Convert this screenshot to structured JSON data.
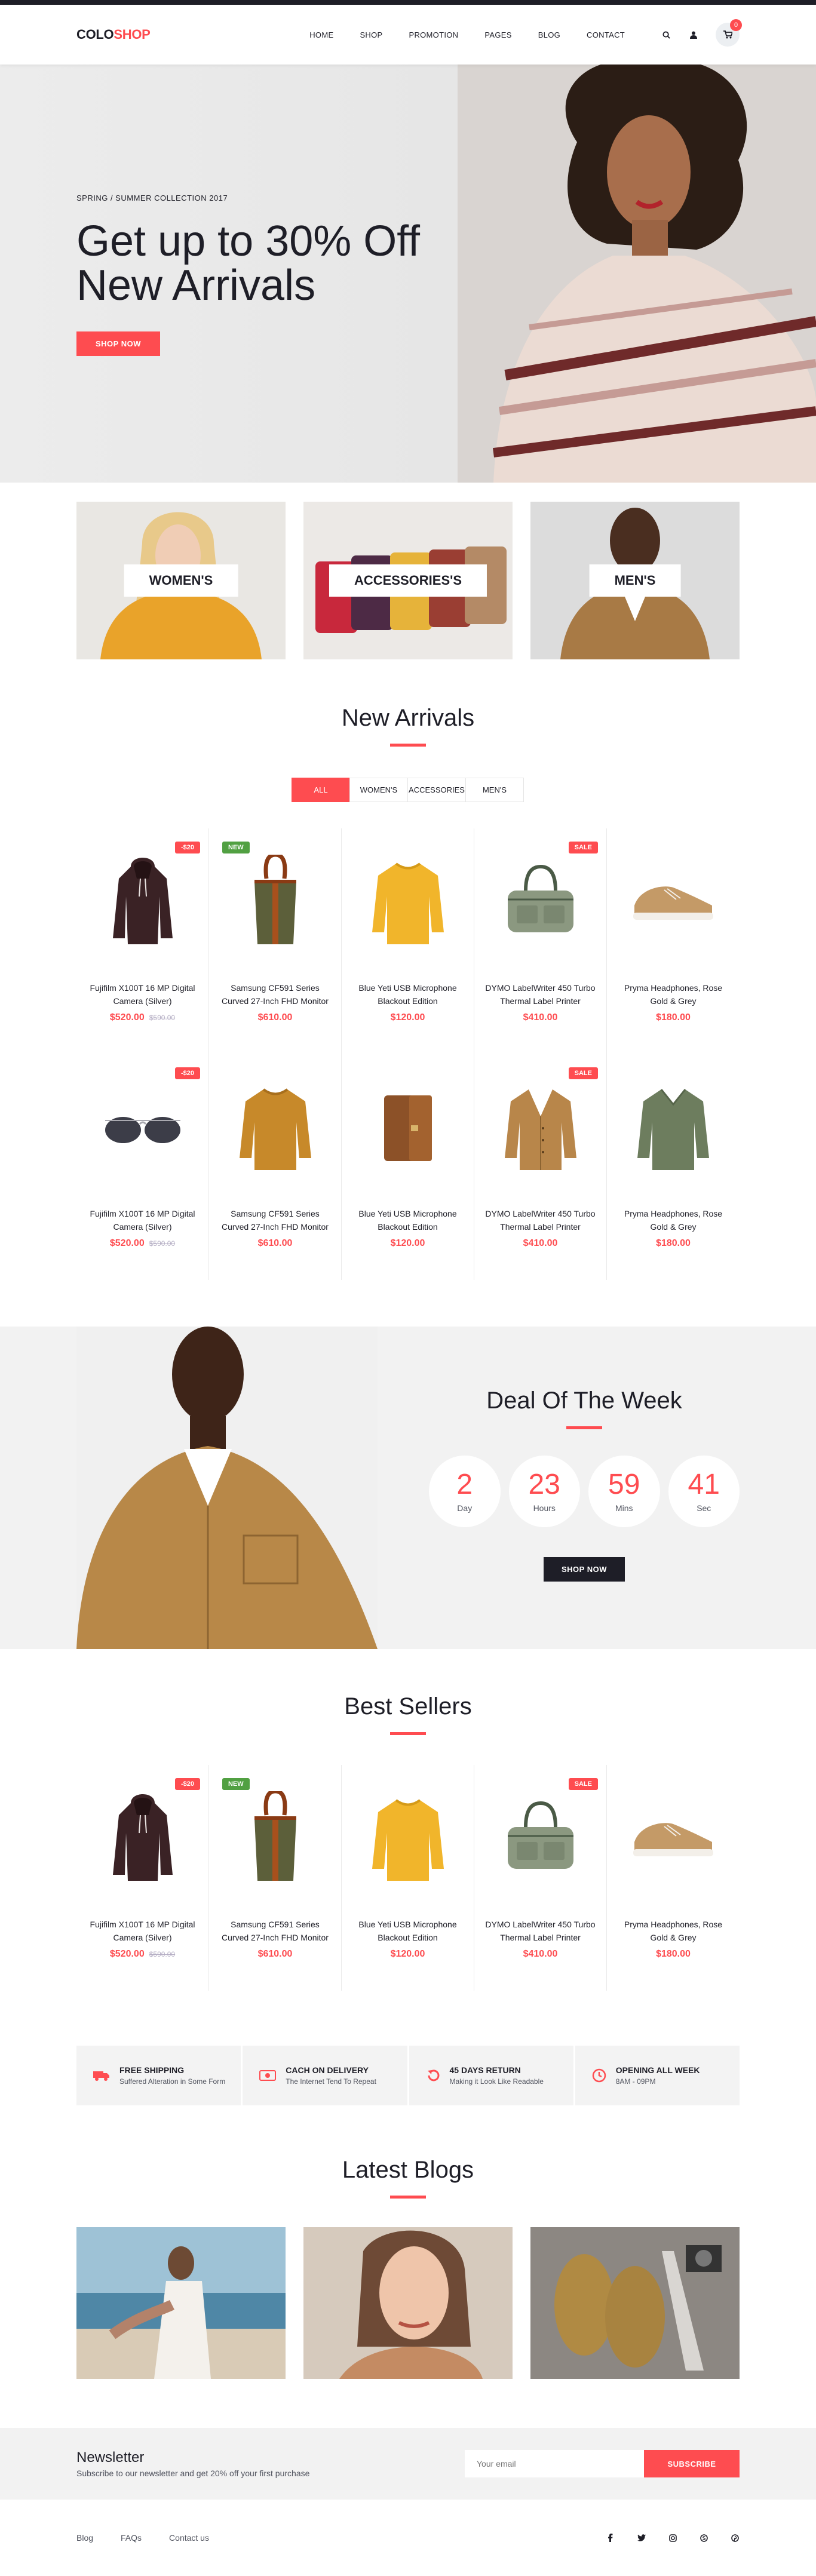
{
  "brand": {
    "part1": "COLO",
    "part2": "SHOP"
  },
  "nav": [
    "HOME",
    "SHOP",
    "PROMOTION",
    "PAGES",
    "BLOG",
    "CONTACT"
  ],
  "header_icons": [
    "search-icon",
    "user-icon",
    "cart-icon"
  ],
  "cart_count": "0",
  "hero": {
    "subtitle": "SPRING / SUMMER COLLECTION 2017",
    "title_line1": "Get up to 30% Off",
    "title_line2": "New Arrivals",
    "button": "SHOP NOW"
  },
  "categories": [
    "WOMEN'S",
    "ACCESSORIES'S",
    "MEN'S"
  ],
  "new_arrivals": {
    "title": "New Arrivals",
    "filters": [
      "ALL",
      "WOMEN'S",
      "ACCESSORIES",
      "MEN'S"
    ],
    "active_filter": "ALL",
    "products": [
      {
        "name": "Fujifilm X100T 16 MP Digital Camera (Silver)",
        "price": "$520.00",
        "old_price": "$590.00",
        "badge": "-$20",
        "badge_color": "red",
        "image": "hoodie"
      },
      {
        "name": "Samsung CF591 Series Curved 27-Inch FHD Monitor",
        "price": "$610.00",
        "badge": "NEW",
        "badge_color": "green",
        "image": "bucket-bag"
      },
      {
        "name": "Blue Yeti USB Microphone Blackout Edition",
        "price": "$120.00",
        "image": "yellow-sweater"
      },
      {
        "name": "DYMO LabelWriter 450 Turbo Thermal Label Printer",
        "price": "$410.00",
        "badge": "SALE",
        "badge_color": "red",
        "image": "duffel-bag"
      },
      {
        "name": "Pryma Headphones, Rose Gold & Grey",
        "price": "$180.00",
        "image": "sneaker"
      },
      {
        "name": "Fujifilm X100T 16 MP Digital Camera (Silver)",
        "price": "$520.00",
        "old_price": "$590.00",
        "badge": "-$20",
        "badge_color": "red",
        "image": "sunglasses"
      },
      {
        "name": "Samsung CF591 Series Curved 27-Inch FHD Monitor",
        "price": "$610.00",
        "image": "mustard-sweater"
      },
      {
        "name": "Blue Yeti USB Microphone Blackout Edition",
        "price": "$120.00",
        "image": "wallet"
      },
      {
        "name": "DYMO LabelWriter 450 Turbo Thermal Label Printer",
        "price": "$410.00",
        "badge": "SALE",
        "badge_color": "red",
        "image": "cardigan"
      },
      {
        "name": "Pryma Headphones, Rose Gold & Grey",
        "price": "$180.00",
        "image": "green-sweater"
      }
    ]
  },
  "deal": {
    "title": "Deal Of The Week",
    "timer": [
      {
        "value": "2",
        "unit": "Day"
      },
      {
        "value": "23",
        "unit": "Hours"
      },
      {
        "value": "59",
        "unit": "Mins"
      },
      {
        "value": "41",
        "unit": "Sec"
      }
    ],
    "button": "SHOP NOW"
  },
  "best_sellers": {
    "title": "Best Sellers",
    "products": [
      {
        "name": "Fujifilm X100T 16 MP Digital Camera (Silver)",
        "price": "$520.00",
        "old_price": "$590.00",
        "badge": "-$20",
        "badge_color": "red",
        "image": "hoodie"
      },
      {
        "name": "Samsung CF591 Series Curved 27-Inch FHD Monitor",
        "price": "$610.00",
        "badge": "NEW",
        "badge_color": "green",
        "image": "bucket-bag"
      },
      {
        "name": "Blue Yeti USB Microphone Blackout Edition",
        "price": "$120.00",
        "image": "yellow-sweater"
      },
      {
        "name": "DYMO LabelWriter 450 Turbo Thermal Label Printer",
        "price": "$410.00",
        "badge": "SALE",
        "badge_color": "red",
        "image": "duffel-bag"
      },
      {
        "name": "Pryma Headphones, Rose Gold & Grey",
        "price": "$180.00",
        "image": "sneaker"
      }
    ]
  },
  "benefits": [
    {
      "icon": "truck-icon",
      "title": "FREE SHIPPING",
      "subtitle": "Suffered Alteration in Some Form"
    },
    {
      "icon": "money-icon",
      "title": "CACH ON DELIVERY",
      "subtitle": "The Internet Tend To Repeat"
    },
    {
      "icon": "undo-icon",
      "title": "45 DAYS RETURN",
      "subtitle": "Making it Look Like Readable"
    },
    {
      "icon": "clock-icon",
      "title": "OPENING ALL WEEK",
      "subtitle": "8AM - 09PM"
    }
  ],
  "blogs": {
    "title": "Latest Blogs"
  },
  "newsletter": {
    "title": "Newsletter",
    "subtitle": "Subscribe to our newsletter and get 20% off your first purchase",
    "placeholder": "Your email",
    "button": "SUBSCRIBE"
  },
  "footer": {
    "links": [
      "Blog",
      "FAQs",
      "Contact us"
    ],
    "social": [
      "facebook-icon",
      "twitter-icon",
      "instagram-icon",
      "skype-icon",
      "pinterest-icon"
    ]
  },
  "colors": {
    "accent": "#fe4c50",
    "dark": "#1e1e27",
    "green": "#51a042",
    "light_bg": "#f2f2f2"
  }
}
